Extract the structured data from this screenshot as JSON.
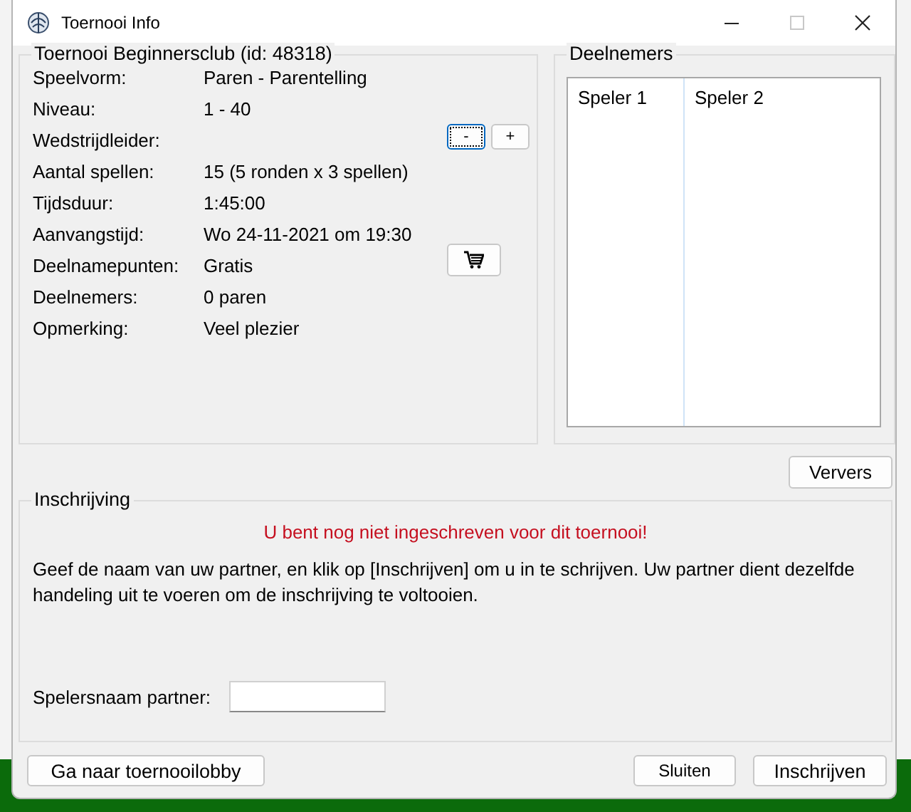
{
  "window": {
    "title": "Toernooi Info",
    "controls": [
      {
        "kind": "minimize",
        "disabled": false
      },
      {
        "kind": "maximize",
        "disabled": true
      },
      {
        "kind": "close",
        "disabled": false
      }
    ]
  },
  "tournament": {
    "title": "Toernooi Beginnersclub (id: 48318)",
    "fields": [
      {
        "kind": "text",
        "label": "Speelvorm:",
        "value": "Paren - Parentelling"
      },
      {
        "kind": "text",
        "label": "Niveau:",
        "value": "1 - 40"
      },
      {
        "kind": "stepper",
        "label": "Wedstrijdleider:",
        "buttons": [
          {
            "label": "-",
            "focused": true
          },
          {
            "label": "+",
            "focused": false
          }
        ]
      },
      {
        "kind": "text",
        "label": "Aantal spellen:",
        "value": "15 (5 ronden x 3 spellen)"
      },
      {
        "kind": "text",
        "label": "Tijdsduur:",
        "value": "1:45:00"
      },
      {
        "kind": "text",
        "label": "Aanvangstijd:",
        "value": "Wo 24-11-2021 om 19:30"
      },
      {
        "kind": "shop",
        "label": "Deelnamepunten:",
        "value": "Gratis"
      },
      {
        "kind": "text",
        "label": "Deelnemers:",
        "value": "0 paren"
      },
      {
        "kind": "text",
        "label": "Opmerking:",
        "value": "Veel plezier"
      }
    ]
  },
  "participants": {
    "title": "Deelnemers",
    "columns": [
      "Speler 1",
      "Speler 2"
    ]
  },
  "refresh_button": "Ververs",
  "registration": {
    "title": "Inschrijving",
    "warning": "U bent nog niet ingeschreven voor dit toernooi!",
    "instructions": "Geef de naam van uw partner, en klik op [Inschrijven] om u in te schrijven. Uw partner dient dezelfde handeling uit te voeren om de inschrijving te voltooien.",
    "partner_label": "Spelersnaam partner:"
  },
  "footer": {
    "lobby_button": "Ga naar toernooilobby",
    "close_button": "Sluiten",
    "register_button": "Inschrijven"
  }
}
